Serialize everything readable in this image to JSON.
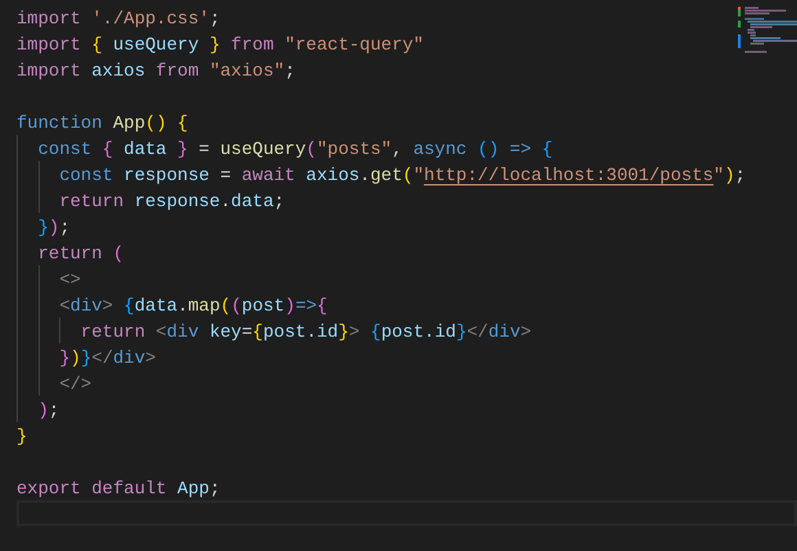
{
  "editor": {
    "lines": [
      {
        "current": false,
        "tokens": [
          {
            "kind": "keyword",
            "text": "import"
          },
          {
            "kind": "string",
            "text": " './App.css'"
          },
          {
            "kind": "punct",
            "text": ";"
          }
        ]
      },
      {
        "current": false,
        "tokens": [
          {
            "kind": "keyword",
            "text": "import"
          },
          {
            "kind": "b1",
            "text": " {"
          },
          {
            "kind": "var",
            "text": " useQuery"
          },
          {
            "kind": "b1",
            "text": " }"
          },
          {
            "kind": "keyword",
            "text": " from"
          },
          {
            "kind": "string",
            "text": " \"react-query\""
          }
        ]
      },
      {
        "current": false,
        "tokens": [
          {
            "kind": "keyword",
            "text": "import"
          },
          {
            "kind": "var",
            "text": " axios"
          },
          {
            "kind": "keyword",
            "text": " from"
          },
          {
            "kind": "string",
            "text": " \"axios\""
          },
          {
            "kind": "punct",
            "text": ";"
          }
        ]
      },
      {
        "current": false
      },
      {
        "current": false,
        "tokens": [
          {
            "kind": "storage",
            "text": "function"
          },
          {
            "kind": "func",
            "text": " App"
          },
          {
            "kind": "b1",
            "text": "()"
          },
          {
            "kind": "b1",
            "text": " {"
          }
        ]
      },
      {
        "current": false,
        "tokens": [
          {
            "kind": "storage",
            "text": "  const"
          },
          {
            "kind": "b2",
            "text": " {"
          },
          {
            "kind": "var",
            "text": " data"
          },
          {
            "kind": "b2",
            "text": " }"
          },
          {
            "kind": "punct",
            "text": " ="
          },
          {
            "kind": "func",
            "text": " useQuery"
          },
          {
            "kind": "b2",
            "text": "("
          },
          {
            "kind": "string",
            "text": "\"posts\""
          },
          {
            "kind": "punct",
            "text": ","
          },
          {
            "kind": "storage",
            "text": " async"
          },
          {
            "kind": "b3",
            "text": " ()"
          },
          {
            "kind": "storage",
            "text": " =>"
          },
          {
            "kind": "b3",
            "text": " {"
          }
        ]
      },
      {
        "current": false,
        "tokens": [
          {
            "kind": "storage",
            "text": "    const"
          },
          {
            "kind": "var",
            "text": " response"
          },
          {
            "kind": "punct",
            "text": " ="
          },
          {
            "kind": "keyword",
            "text": " await"
          },
          {
            "kind": "var",
            "text": " axios"
          },
          {
            "kind": "punct",
            "text": "."
          },
          {
            "kind": "func",
            "text": "get"
          },
          {
            "kind": "b1",
            "text": "("
          },
          {
            "kind": "string",
            "text": "\""
          },
          {
            "kind": "link",
            "text": "http://localhost:3001/posts"
          },
          {
            "kind": "string",
            "text": "\""
          },
          {
            "kind": "b1",
            "text": ")"
          },
          {
            "kind": "punct",
            "text": ";"
          }
        ]
      },
      {
        "current": false,
        "tokens": [
          {
            "kind": "keyword",
            "text": "    return"
          },
          {
            "kind": "var",
            "text": " response"
          },
          {
            "kind": "punct",
            "text": "."
          },
          {
            "kind": "var",
            "text": "data"
          },
          {
            "kind": "punct",
            "text": ";"
          }
        ]
      },
      {
        "current": false,
        "tokens": [
          {
            "kind": "b3",
            "text": "  }"
          },
          {
            "kind": "b2",
            "text": ")"
          },
          {
            "kind": "punct",
            "text": ";"
          }
        ]
      },
      {
        "current": false,
        "tokens": [
          {
            "kind": "keyword",
            "text": "  return"
          },
          {
            "kind": "b2",
            "text": " ("
          }
        ]
      },
      {
        "current": false,
        "tokens": [
          {
            "kind": "tag",
            "text": "    <>"
          }
        ]
      },
      {
        "current": false,
        "tokens": [
          {
            "kind": "tag",
            "text": "    <"
          },
          {
            "kind": "storage",
            "text": "div"
          },
          {
            "kind": "tag",
            "text": ">"
          },
          {
            "kind": "b3",
            "text": " {"
          },
          {
            "kind": "var",
            "text": "data"
          },
          {
            "kind": "punct",
            "text": "."
          },
          {
            "kind": "func",
            "text": "map"
          },
          {
            "kind": "b1",
            "text": "("
          },
          {
            "kind": "b2",
            "text": "("
          },
          {
            "kind": "var",
            "text": "post"
          },
          {
            "kind": "b2",
            "text": ")"
          },
          {
            "kind": "storage",
            "text": "=>"
          },
          {
            "kind": "b2",
            "text": "{"
          }
        ]
      },
      {
        "current": false,
        "tokens": [
          {
            "kind": "keyword",
            "text": "      return"
          },
          {
            "kind": "tag",
            "text": " <"
          },
          {
            "kind": "storage",
            "text": "div"
          },
          {
            "kind": "var",
            "text": " key"
          },
          {
            "kind": "punct",
            "text": "="
          },
          {
            "kind": "b1",
            "text": "{"
          },
          {
            "kind": "var",
            "text": "post.id"
          },
          {
            "kind": "b1",
            "text": "}"
          },
          {
            "kind": "tag",
            "text": ">"
          },
          {
            "kind": "b3",
            "text": " {"
          },
          {
            "kind": "var",
            "text": "post.id"
          },
          {
            "kind": "b3",
            "text": "}"
          },
          {
            "kind": "tag",
            "text": "</"
          },
          {
            "kind": "storage",
            "text": "div"
          },
          {
            "kind": "tag",
            "text": ">"
          }
        ]
      },
      {
        "current": false,
        "tokens": [
          {
            "kind": "b2",
            "text": "    }"
          },
          {
            "kind": "b1",
            "text": ")"
          },
          {
            "kind": "b3",
            "text": "}"
          },
          {
            "kind": "tag",
            "text": "</"
          },
          {
            "kind": "storage",
            "text": "div"
          },
          {
            "kind": "tag",
            "text": ">"
          }
        ]
      },
      {
        "current": false,
        "tokens": [
          {
            "kind": "tag",
            "text": "    </>"
          }
        ]
      },
      {
        "current": false,
        "tokens": [
          {
            "kind": "b2",
            "text": "  )"
          },
          {
            "kind": "punct",
            "text": ";"
          }
        ]
      },
      {
        "current": false,
        "tokens": [
          {
            "kind": "b1",
            "text": "}"
          }
        ]
      },
      {
        "current": false
      },
      {
        "current": false,
        "tokens": [
          {
            "kind": "keyword",
            "text": "export"
          },
          {
            "kind": "keyword",
            "text": " default"
          },
          {
            "kind": "var",
            "text": " App"
          },
          {
            "kind": "punct",
            "text": ";"
          }
        ]
      },
      {
        "current": true
      }
    ]
  }
}
